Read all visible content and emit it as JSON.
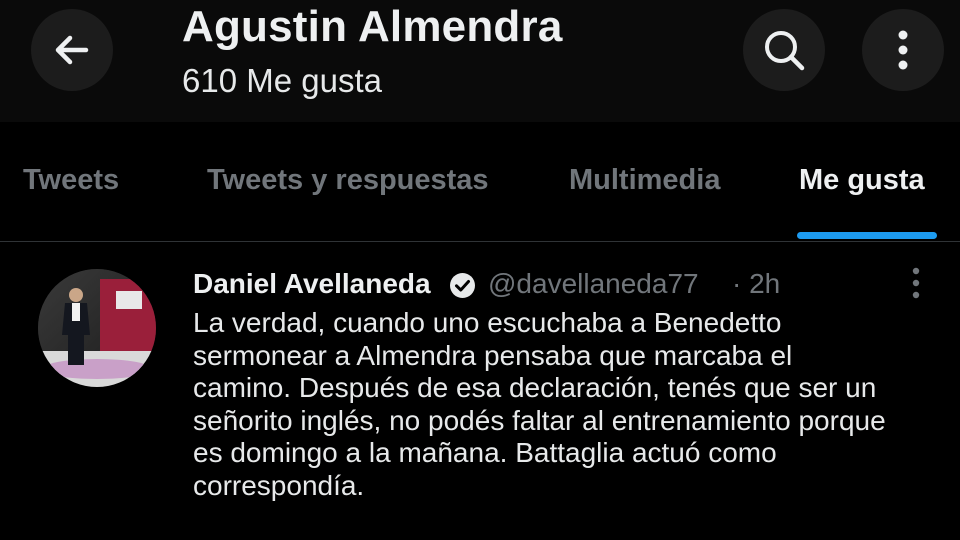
{
  "header": {
    "title": "Agustin Almendra",
    "subtitle": "610 Me gusta",
    "back_icon": "arrow-left-icon",
    "search_icon": "search-icon",
    "more_icon": "more-vertical-icon"
  },
  "tabs": [
    {
      "label": "Tweets",
      "active": false
    },
    {
      "label": "Tweets y respuestas",
      "active": false
    },
    {
      "label": "Multimedia",
      "active": false
    },
    {
      "label": "Me gusta",
      "active": true
    }
  ],
  "tweet": {
    "author_name": "Daniel Avellaneda",
    "verified_icon": "verified-badge-icon",
    "handle": "@davellaneda77",
    "time": "· 2h",
    "text": "La verdad, cuando uno escuchaba a Benedetto\nsermonear a Almendra pensaba que marcaba el\ncamino. Después de esa declaración, tenés que ser un\nseñorito inglés, no podés faltar al entrenamiento porque\nes domingo a la mañana. Battaglia actuó como\ncorrespondía.",
    "more_icon": "more-vertical-icon"
  },
  "colors": {
    "background": "#000000",
    "header_background": "#0a0a0a",
    "text_primary": "#e7e9ea",
    "text_secondary": "#71767b",
    "accent": "#1d9bf0",
    "divider": "#2f3336"
  }
}
